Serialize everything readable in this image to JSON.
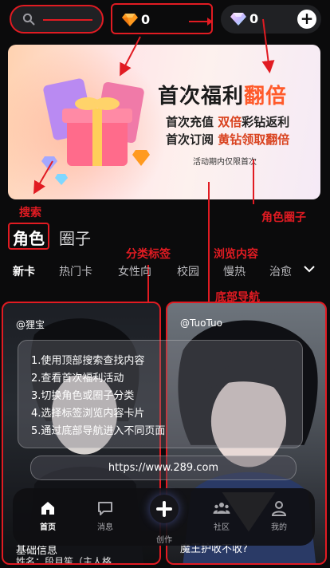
{
  "top_bar": {
    "search_placeholder": "",
    "diamond_count": "0",
    "gem_count": "0",
    "add_label": "+"
  },
  "banner": {
    "title_part1": "首次福利",
    "title_part2": "翻倍",
    "line1_a": "首次充值",
    "line1_b": "双倍",
    "line1_c": "彩钻返利",
    "line2_a": "首次订阅",
    "line2_b": "黄钻领取翻倍",
    "note": "活动期内仅限首次"
  },
  "annotations": {
    "search": "搜索",
    "role_circle": "角色圈子",
    "tags": "分类标签",
    "browse": "浏览内容",
    "bottom_nav": "底部导航"
  },
  "categories": [
    {
      "label": "角色",
      "active": true
    },
    {
      "label": "圈子",
      "active": false
    }
  ],
  "tags": [
    {
      "label": "新卡",
      "active": true
    },
    {
      "label": "热门卡",
      "active": false
    },
    {
      "label": "女性向",
      "active": false
    },
    {
      "label": "校园",
      "active": false
    },
    {
      "label": "慢热",
      "active": false
    },
    {
      "label": "治愈",
      "active": false
    }
  ],
  "cards": [
    {
      "handle": "@狸宝",
      "footer": "基础信息",
      "footer2": "姓名：段月笙（主人格"
    },
    {
      "handle": "@TuoTuo",
      "footer": "魔王护收不收?"
    }
  ],
  "instructions": [
    "1.使用顶部搜索查找内容",
    "2.查看首次福利活动",
    "3.切换角色或圈子分类",
    "4.选择标签浏览内容卡片",
    "5.通过底部导航进入不同页面"
  ],
  "url": "https://www.289.com",
  "bottom_nav": [
    {
      "label": "首页",
      "icon": "home-icon",
      "active": true
    },
    {
      "label": "消息",
      "icon": "message-icon",
      "active": false
    },
    {
      "label": "创作",
      "icon": "plus-icon",
      "active": false
    },
    {
      "label": "社区",
      "icon": "community-icon",
      "active": false
    },
    {
      "label": "我的",
      "icon": "profile-icon",
      "active": false
    }
  ],
  "colors": {
    "accent_red": "#e11b22",
    "banner_highlight": "#ff5a2a",
    "background": "#0b0b0c"
  }
}
